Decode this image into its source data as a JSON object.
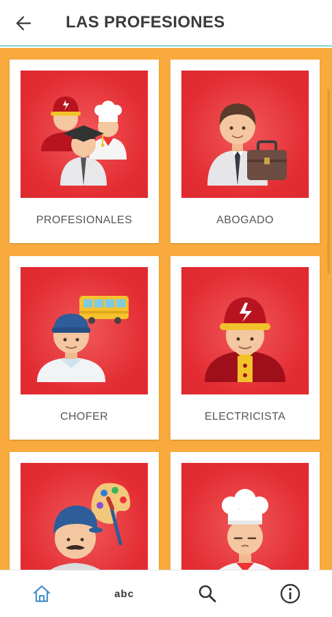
{
  "appbar": {
    "title": "LAS PROFESIONES",
    "back_icon": "arrow-left-icon"
  },
  "cards": [
    {
      "label": "PROFESIONALES",
      "icon": "professionals-group-icon"
    },
    {
      "label": "ABOGADO",
      "icon": "lawyer-icon"
    },
    {
      "label": "CHOFER",
      "icon": "driver-bus-icon"
    },
    {
      "label": "ELECTRICISTA",
      "icon": "electrician-icon"
    },
    {
      "label": "",
      "icon": "painter-icon"
    },
    {
      "label": "",
      "icon": "chef-icon"
    }
  ],
  "bottom_nav": {
    "items": [
      {
        "icon": "home-icon",
        "active": true
      },
      {
        "icon": "abc-icon",
        "glyph": "abc"
      },
      {
        "icon": "search-icon"
      },
      {
        "icon": "info-icon"
      }
    ]
  },
  "colors": {
    "background": "#f9aa3c",
    "card_image_bg": "#e32d33",
    "accent_teal": "#7fd6d0",
    "nav_active": "#4a90c8"
  }
}
